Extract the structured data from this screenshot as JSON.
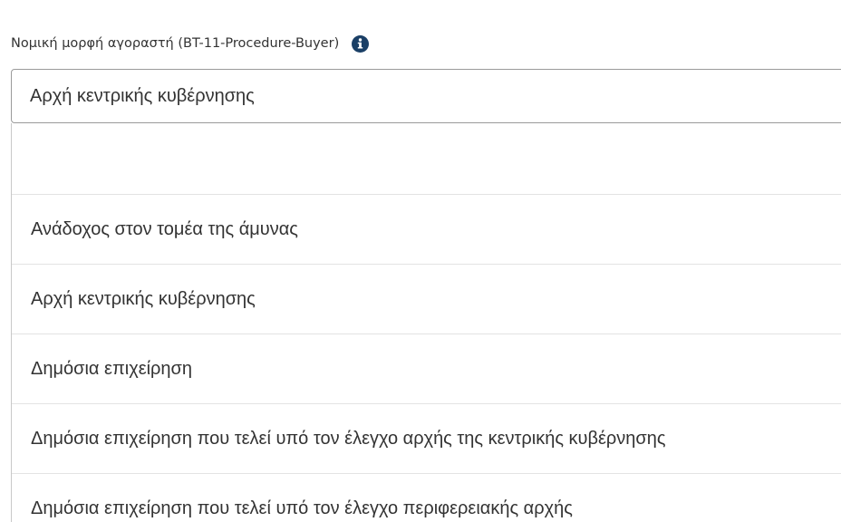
{
  "field": {
    "label": "Νομική μορφή αγοραστή (BT-11-Procedure-Buyer)",
    "info_icon": "info-circle-icon",
    "selected_value": "Αρχή κεντρικής κυβέρνησης"
  },
  "dropdown": {
    "options": [
      "",
      "Ανάδοχος στον τομέα της άμυνας",
      "Αρχή κεντρικής κυβέρνησης",
      "Δημόσια επιχείρηση",
      "Δημόσια επιχείρηση που τελεί υπό τον έλεγχο αρχής της κεντρικής κυβέρνησης",
      "Δημόσια επιχείρηση που τελεί υπό τον έλεγχο περιφερειακής αρχής"
    ]
  },
  "colors": {
    "text": "#333333",
    "info_icon": "#1a3f66",
    "border": "#9a9a9a",
    "divider": "#e3e3e3"
  }
}
